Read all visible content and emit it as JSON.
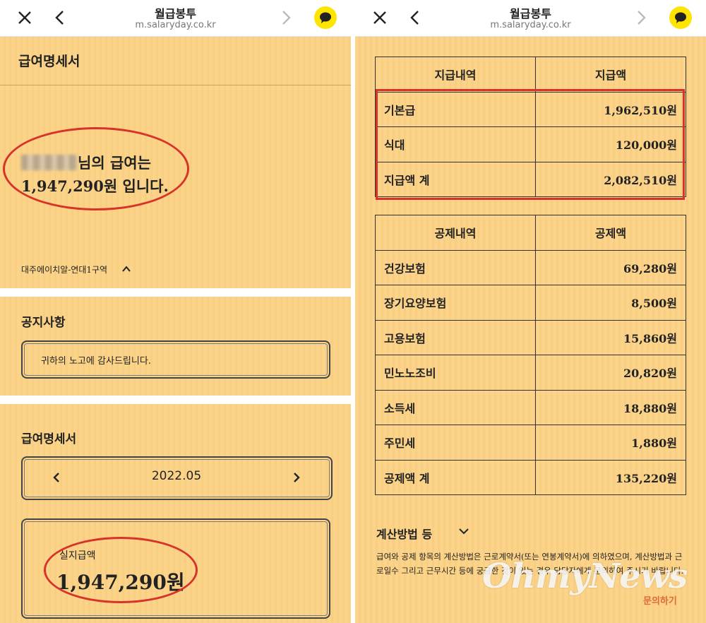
{
  "topbar": {
    "title": "월급봉투",
    "url": "m.salaryday.co.kr",
    "icons": {
      "close": "close-icon",
      "back": "chevron-left-icon",
      "forward": "chevron-right-icon",
      "chat": "kakao-chat-icon"
    }
  },
  "left": {
    "heading": "급여명세서",
    "greeting_line1": "님의 급여는",
    "greeting_line2": "1,947,290원 입니다.",
    "branch": "대주에이치알-연대1구역",
    "notice": {
      "title": "공지사항",
      "text": "귀하의 노고에 감사드립니다."
    },
    "payslip": {
      "title": "급여명세서",
      "month": "2022.05",
      "net_label": "실지급액",
      "net_value": "1,947,290원"
    }
  },
  "right": {
    "payments": {
      "header": [
        "지급내역",
        "지급액"
      ],
      "rows": [
        {
          "item": "기본급",
          "amount": "1,962,510원"
        },
        {
          "item": "식대",
          "amount": "120,000원"
        },
        {
          "item": "지급액 계",
          "amount": "2,082,510원"
        }
      ]
    },
    "deductions": {
      "header": [
        "공제내역",
        "공제액"
      ],
      "rows": [
        {
          "item": "건강보험",
          "amount": "69,280원"
        },
        {
          "item": "장기요양보험",
          "amount": "8,500원"
        },
        {
          "item": "고용보험",
          "amount": "15,860원"
        },
        {
          "item": "민노노조비",
          "amount": "20,820원"
        },
        {
          "item": "소득세",
          "amount": "18,880원"
        },
        {
          "item": "주민세",
          "amount": "1,880원"
        },
        {
          "item": "공제액 계",
          "amount": "135,220원"
        }
      ]
    },
    "calc_method": {
      "title": "계산방법 등",
      "note": "급여와 공제 항목의 계산방법은 근로계약서(또는 연봉계약서)에 의하였으며, 계산방법과 근로일수 그리고 근무시간 등에 궁금한 것이 있는 경우 담당자에게 문의하여 주시기 바랍니다."
    },
    "watermark": "OhmyNews",
    "watermark_sub": "문의하기"
  },
  "colors": {
    "background": "#fbd48a",
    "annotation_red": "#d8332a",
    "kakao_yellow": "#fee500"
  }
}
